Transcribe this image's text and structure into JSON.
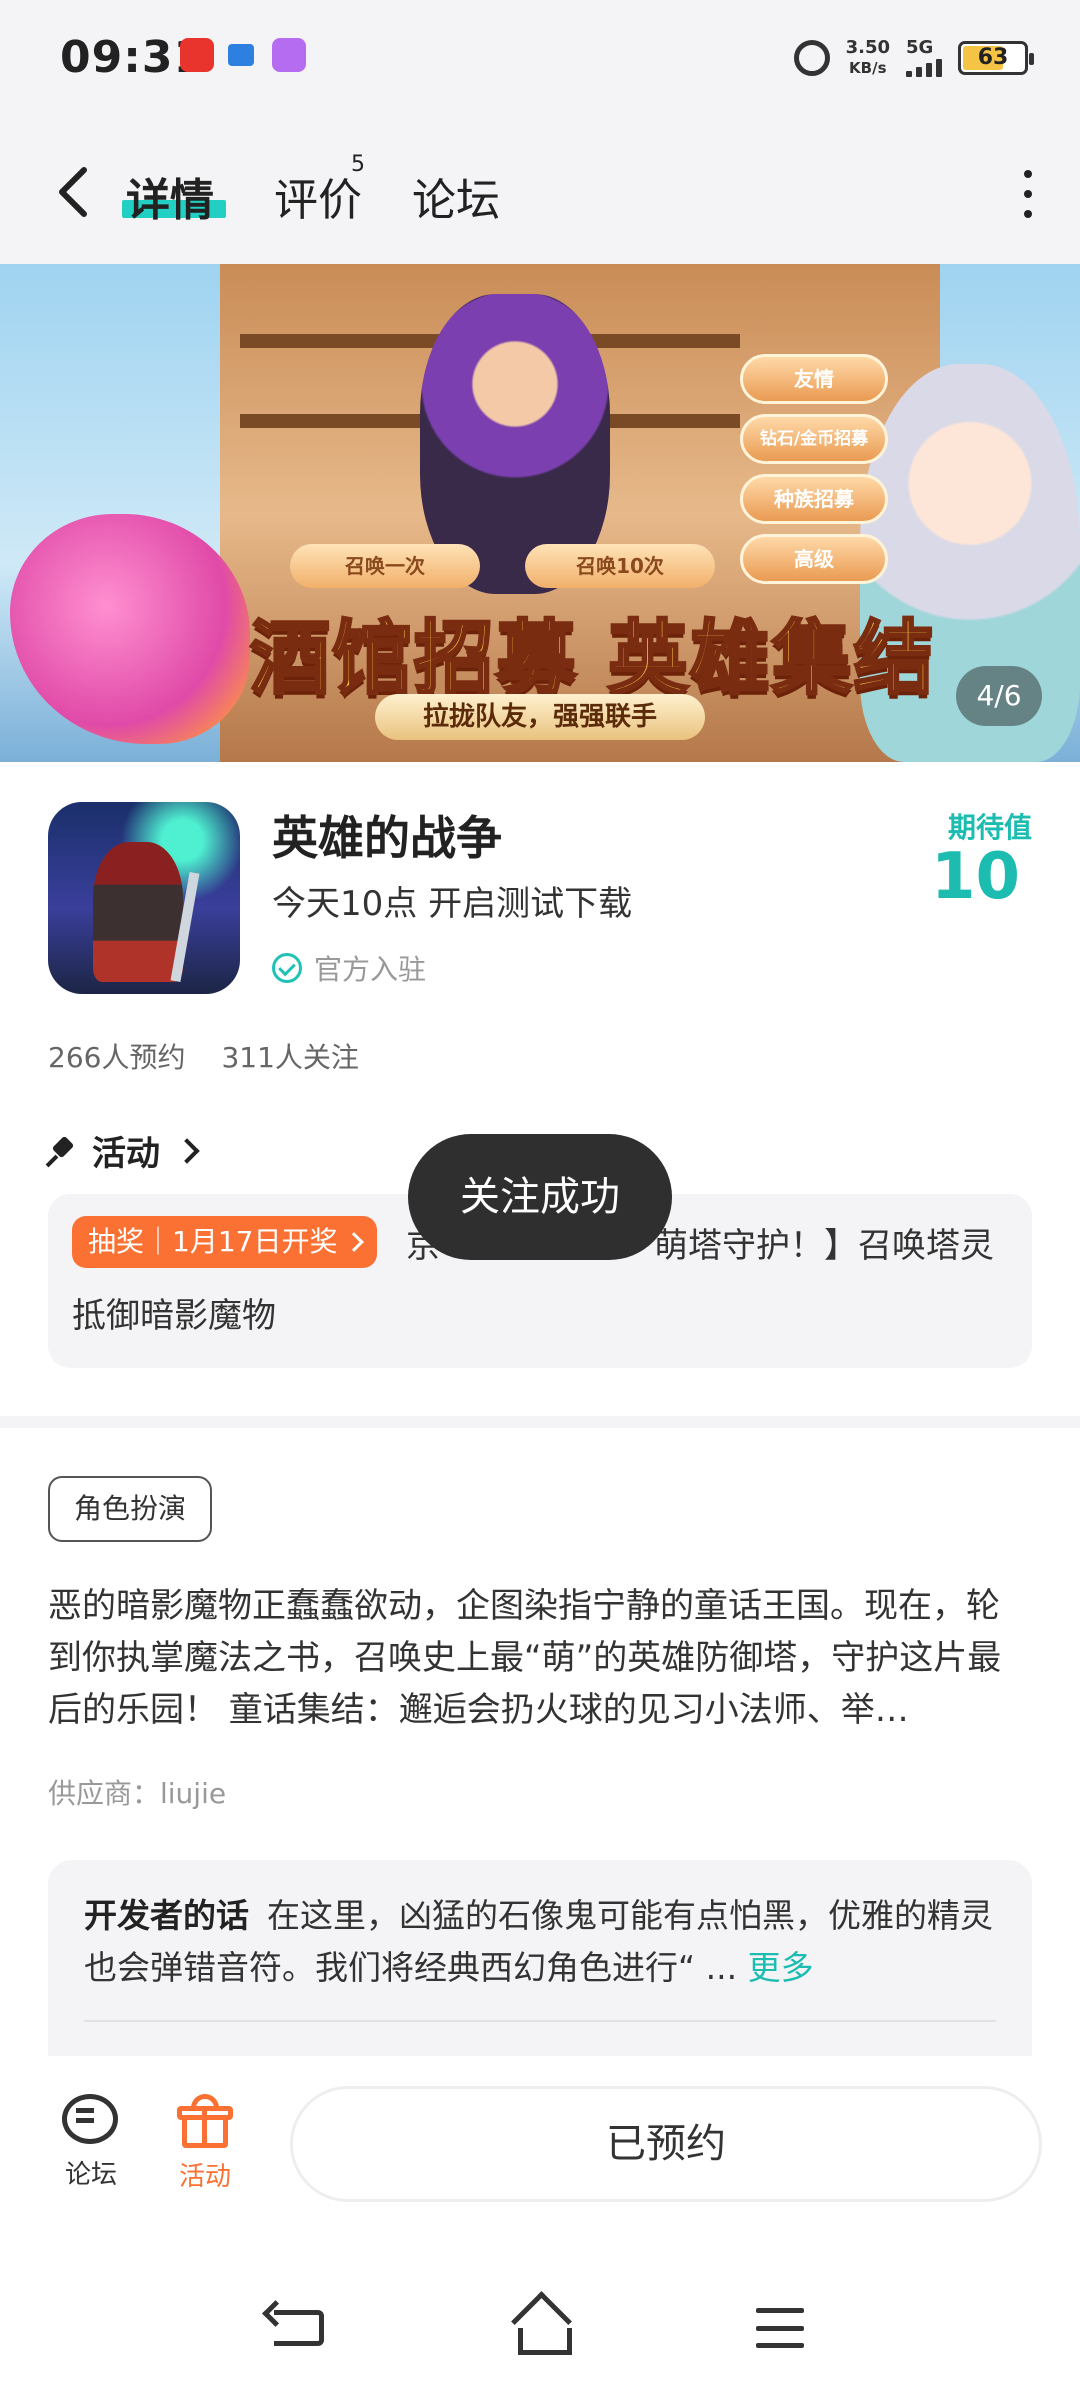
{
  "status_bar": {
    "time": "09:31",
    "speed_value": "3.50",
    "speed_unit": "KB/s",
    "network": "5G",
    "battery": "63",
    "app_icons": [
      {
        "name": "shopping-app-icon",
        "color": "#e8342c"
      },
      {
        "name": "cloud-app-icon",
        "color": "#2d7fe0"
      },
      {
        "name": "assistant-app-icon",
        "color": "#b56cf0"
      }
    ]
  },
  "nav": {
    "back_icon": "chevron-left-icon",
    "tabs": [
      {
        "label": "详情",
        "active": true
      },
      {
        "label": "评价",
        "badge": "5"
      },
      {
        "label": "论坛"
      }
    ],
    "more_icon": "more-vertical-icon"
  },
  "banner": {
    "headline": "酒馆招募 英雄集结",
    "subline": "拉拢队友，强强联手",
    "summon_once": "召唤一次",
    "summon_ten": "召唤10次",
    "menu_items": [
      "友情",
      "钻石/金币招募",
      "种族招募",
      "高级"
    ],
    "counter": "4/6"
  },
  "app": {
    "name": "英雄的战争",
    "subtitle": "今天10点 开启测试下载",
    "official": "官方入驻",
    "expect_label": "期待值",
    "expect_value": "10",
    "reservations": "266人预约",
    "followers": "311人关注"
  },
  "activity": {
    "section_title": "活动",
    "tag": "抽奖｜1月17日开奖",
    "text_line1": "京",
    "text_line1_rest": "萌塔守护！】召唤塔灵",
    "text_line2": "抵御暗影魔物"
  },
  "toast": "关注成功",
  "genre": "角色扮演",
  "description": "恶的暗影魔物正蠢蠢欲动，企图染指宁静的童话王国。现在，轮到你执掌魔法之书，召唤史上最“萌”的英雄防御塔，守护这片最后的乐园！ 童话集结：邂逅会扔火球的见习小法师、举…",
  "supplier": "供应商：liujie",
  "developer": {
    "title": "开发者的话",
    "text": "在这里，凶猛的石像鬼可能有点怕黑，优雅的精灵也会弹错音符。我们将经典西幻角色进行“ ...",
    "more": "更多"
  },
  "bottom_bar": {
    "forum_label": "论坛",
    "activity_label": "活动",
    "reserved_label": "已预约",
    "accent": "#fb7133"
  }
}
